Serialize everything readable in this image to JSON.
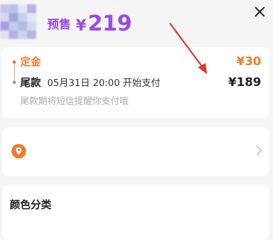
{
  "header": {
    "presale_label": "预售",
    "price_currency": "¥",
    "price_amount": "219"
  },
  "payment": {
    "deposit_label": "定金",
    "deposit_amount": "¥30",
    "balance_label": "尾款",
    "balance_time": "05月31日 20:00 开始支付",
    "balance_amount": "¥189",
    "balance_note": "尾款期将短信提醒你支付哦"
  },
  "sku": {
    "color_label": "颜色分类"
  },
  "colors": {
    "accent_purple": "#9b4be6",
    "accent_orange": "#f07c2b",
    "annotation_red": "#d93a2b"
  },
  "icons": {
    "close": "close-icon",
    "location": "location-pin-icon",
    "chevron": "chevron-right-icon"
  }
}
